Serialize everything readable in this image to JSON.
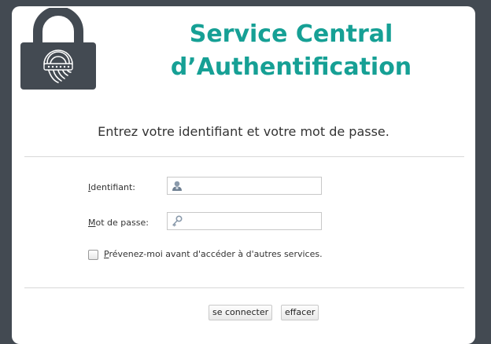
{
  "header": {
    "title_line1": "Service Central",
    "title_line2": "d’Authentification"
  },
  "form": {
    "instructions": "Entrez votre identifiant et votre mot de passe.",
    "username": {
      "label_accesskey": "I",
      "label_rest": "dentifiant:",
      "value": "",
      "icon": "user-icon"
    },
    "password": {
      "label_accesskey": "M",
      "label_rest": "ot de passe:",
      "value": "",
      "icon": "key-icon"
    },
    "warn": {
      "label_accesskey": "P",
      "label_rest": "révenez-moi avant d'accéder à d'autres services.",
      "checked": false
    },
    "submit_label": "se connecter",
    "reset_label": "effacer"
  },
  "colors": {
    "background": "#434a52",
    "accent": "#16a095",
    "card": "#ffffff"
  }
}
